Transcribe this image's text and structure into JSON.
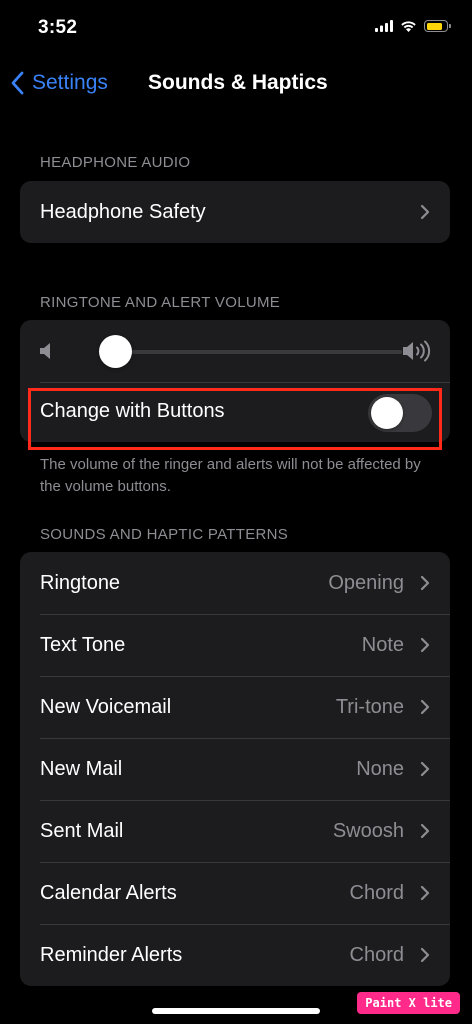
{
  "status_bar": {
    "time": "3:52"
  },
  "nav": {
    "back_label": "Settings",
    "title": "Sounds & Haptics"
  },
  "headphone_audio": {
    "header": "HEADPHONE AUDIO",
    "items": [
      {
        "label": "Headphone Safety"
      }
    ]
  },
  "ringtone_volume": {
    "header": "RINGTONE AND ALERT VOLUME",
    "volume_level": 0.05,
    "change_with_buttons": {
      "label": "Change with Buttons",
      "enabled": false
    },
    "footer": "The volume of the ringer and alerts will not be affected by the volume buttons."
  },
  "sounds_patterns": {
    "header": "SOUNDS AND HAPTIC PATTERNS",
    "items": [
      {
        "label": "Ringtone",
        "value": "Opening"
      },
      {
        "label": "Text Tone",
        "value": "Note"
      },
      {
        "label": "New Voicemail",
        "value": "Tri-tone"
      },
      {
        "label": "New Mail",
        "value": "None"
      },
      {
        "label": "Sent Mail",
        "value": "Swoosh"
      },
      {
        "label": "Calendar Alerts",
        "value": "Chord"
      },
      {
        "label": "Reminder Alerts",
        "value": "Chord"
      }
    ]
  },
  "watermark": "Paint X lite",
  "colors": {
    "accent": "#3a82f7",
    "highlight": "#ff2a1a",
    "battery": "#ffd60a",
    "background": "#000000",
    "group": "#1c1c1e"
  }
}
